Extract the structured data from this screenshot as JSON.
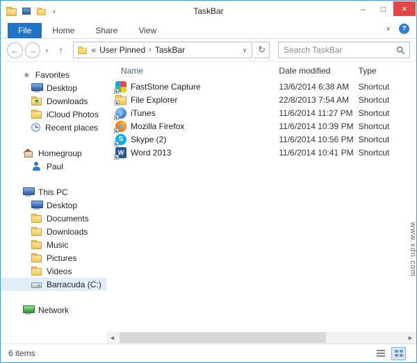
{
  "titlebar": {
    "title": "TaskBar"
  },
  "ribbon": {
    "tabs": [
      "File",
      "Home",
      "Share",
      "View"
    ],
    "active_tab": "File"
  },
  "navigation": {
    "breadcrumb": {
      "overflow": "«",
      "segments": [
        "User Pinned",
        "TaskBar"
      ]
    },
    "search_placeholder": "Search TaskBar"
  },
  "sidebar": {
    "sections": [
      {
        "label": "Favorites",
        "icon": "star-icon",
        "items": [
          {
            "label": "Desktop",
            "icon": "monitor-icon"
          },
          {
            "label": "Downloads",
            "icon": "downloads-folder-icon"
          },
          {
            "label": "iCloud Photos",
            "icon": "folder-icon"
          },
          {
            "label": "Recent places",
            "icon": "recent-places-icon"
          }
        ]
      },
      {
        "label": "Homegroup",
        "icon": "house-icon",
        "items": [
          {
            "label": "Paul",
            "icon": "user-icon"
          }
        ]
      },
      {
        "label": "This PC",
        "icon": "computer-icon",
        "items": [
          {
            "label": "Desktop",
            "icon": "monitor-icon"
          },
          {
            "label": "Documents",
            "icon": "folder-icon"
          },
          {
            "label": "Downloads",
            "icon": "folder-icon"
          },
          {
            "label": "Music",
            "icon": "folder-icon"
          },
          {
            "label": "Pictures",
            "icon": "folder-icon"
          },
          {
            "label": "Videos",
            "icon": "folder-icon"
          },
          {
            "label": "Barracuda (C:)",
            "icon": "drive-icon",
            "selected": true
          }
        ]
      },
      {
        "label": "Network",
        "icon": "network-icon",
        "items": []
      }
    ]
  },
  "files": {
    "columns": [
      {
        "label": "Name"
      },
      {
        "label": "Date modified"
      },
      {
        "label": "Type"
      }
    ],
    "rows": [
      {
        "name": "FastStone Capture",
        "date_modified": "13/6/2014 6:38 AM",
        "type": "Shortcut",
        "icon": "faststone-icon"
      },
      {
        "name": "File Explorer",
        "date_modified": "22/8/2013 7:54 AM",
        "type": "Shortcut",
        "icon": "folder-icon"
      },
      {
        "name": "iTunes",
        "date_modified": "11/6/2014 11:27 PM",
        "type": "Shortcut",
        "icon": "itunes-icon"
      },
      {
        "name": "Mozilla Firefox",
        "date_modified": "11/6/2014 10:39 PM",
        "type": "Shortcut",
        "icon": "firefox-icon"
      },
      {
        "name": "Skype (2)",
        "date_modified": "11/6/2014 10:56 PM",
        "type": "Shortcut",
        "icon": "skype-icon"
      },
      {
        "name": "Word 2013",
        "date_modified": "11/6/2014 10:41 PM",
        "type": "Shortcut",
        "icon": "word-icon"
      }
    ]
  },
  "statusbar": {
    "item_count": "6 items"
  },
  "watermark": "www.xdn.com",
  "icons": {
    "minimize": "–",
    "maximize": "□",
    "close": "×",
    "back": "←",
    "forward": "→",
    "up": "↑",
    "refresh": "↻",
    "chevron_down": "∨",
    "help": "?",
    "breadcrumb_separator": "›",
    "favorites_star": "★",
    "scroll_left": "◀",
    "scroll_right": "▶"
  },
  "colors": {
    "accent_border": "#3b9ddd",
    "file_tab_blue": "#2173c6",
    "close_red": "#e04848",
    "selection": "#e3edf9"
  }
}
